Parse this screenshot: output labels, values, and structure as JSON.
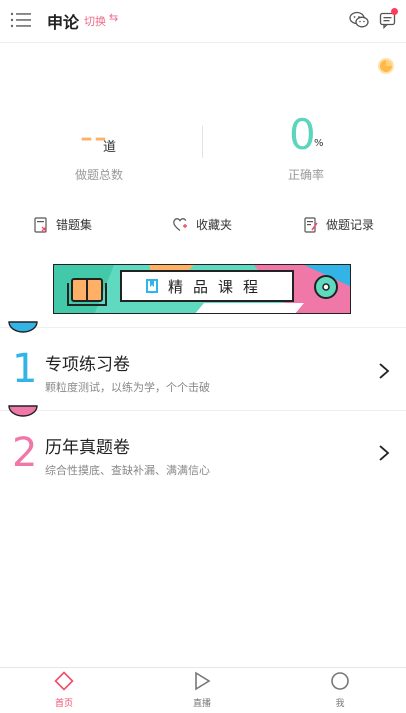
{
  "header": {
    "title": "申论",
    "switch_label": "切换",
    "switch_symbol": "⇆",
    "icons": [
      "menu-icon",
      "wechat-icon",
      "message-icon"
    ],
    "notification_dot_color": "#ff3b5c"
  },
  "stats": {
    "total_questions": {
      "value": "--",
      "unit": "道",
      "label": "做题总数"
    },
    "accuracy": {
      "value": "0",
      "unit": "%",
      "label": "正确率"
    }
  },
  "quick_links": [
    {
      "label": "错题集",
      "icon": "wrong-questions-icon"
    },
    {
      "label": "收藏夹",
      "icon": "favorite-heart-icon"
    },
    {
      "label": "做题记录",
      "icon": "practice-record-icon"
    }
  ],
  "banner": {
    "text": "精品课程"
  },
  "sections": [
    {
      "number": "1",
      "title": "专项练习卷",
      "subtitle": "颗粒度测试，以练为学，个个击破",
      "color": "#33b4e6"
    },
    {
      "number": "2",
      "title": "历年真题卷",
      "subtitle": "综合性摸底、查缺补漏、满满信心",
      "color": "#f078a8"
    }
  ],
  "bottom_nav": [
    {
      "label": "首页",
      "icon": "home-diamond-icon",
      "active": true
    },
    {
      "label": "直播",
      "icon": "live-play-icon",
      "active": false
    },
    {
      "label": "我",
      "icon": "profile-circle-icon",
      "active": false
    }
  ],
  "colors": {
    "accent": "#f04f6c",
    "orange": "#ffb067",
    "teal": "#5bd6bd",
    "blue": "#33b4e6",
    "pink": "#f078a8"
  }
}
